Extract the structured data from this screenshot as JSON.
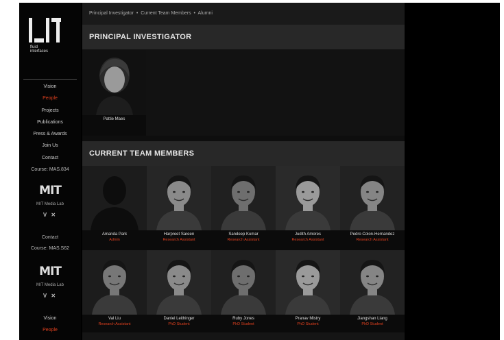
{
  "sidebar": {
    "logo_text": [
      "fluid",
      "interfaces"
    ],
    "nav": [
      {
        "label": "Vision",
        "active": false
      },
      {
        "label": "People",
        "active": true
      },
      {
        "label": "Projects",
        "active": false
      },
      {
        "label": "Publications",
        "active": false
      },
      {
        "label": "Press & Awards",
        "active": false
      },
      {
        "label": "Join Us",
        "active": false
      },
      {
        "label": "Contact",
        "active": false
      }
    ],
    "course_link": "Course: MAS.834",
    "mit_block": {
      "logo": "MIT",
      "sub": "MIT Media Lab",
      "social": "V ✕"
    },
    "contact_label": "Contact",
    "course_link_2": "Course: MAS.S62",
    "mit_block_2": {
      "logo": "MIT",
      "sub": "MIT Media Lab",
      "social": "V ✕"
    },
    "nav_bottom": [
      {
        "label": "Vision",
        "active": false
      },
      {
        "label": "People",
        "active": true
      }
    ]
  },
  "breadcrumb": [
    "Principal Investigator",
    "Current Team Members",
    "Alumni"
  ],
  "pi_section": {
    "title": "PRINCIPAL INVESTIGATOR",
    "person": {
      "name": "Pattie Maes",
      "role": ""
    }
  },
  "team_section": {
    "title": "CURRENT TEAM MEMBERS",
    "members": [
      {
        "name": "Amanda Park",
        "role": "Admin",
        "silhouette": true
      },
      {
        "name": "Harpreet Sareen",
        "role": "Research Assistant"
      },
      {
        "name": "Sandeep Kumar",
        "role": "Research Assistant"
      },
      {
        "name": "Judith Amores",
        "role": "Research Assistant"
      },
      {
        "name": "Pedro Colon-Hernandez",
        "role": "Research Assistant"
      },
      {
        "name": "Val Liu",
        "role": "Research Assistant"
      },
      {
        "name": "Daniel Leithinger",
        "role": "PhD Student"
      },
      {
        "name": "Ruby Jones",
        "role": "PhD Student"
      },
      {
        "name": "Pranav Mistry",
        "role": "PhD Student"
      },
      {
        "name": "Jiangshan Liang",
        "role": "PhD Student"
      }
    ]
  },
  "colors": {
    "accent": "#e0401e",
    "background": "#000000",
    "panel": "#151515",
    "section_header": "#282828"
  }
}
